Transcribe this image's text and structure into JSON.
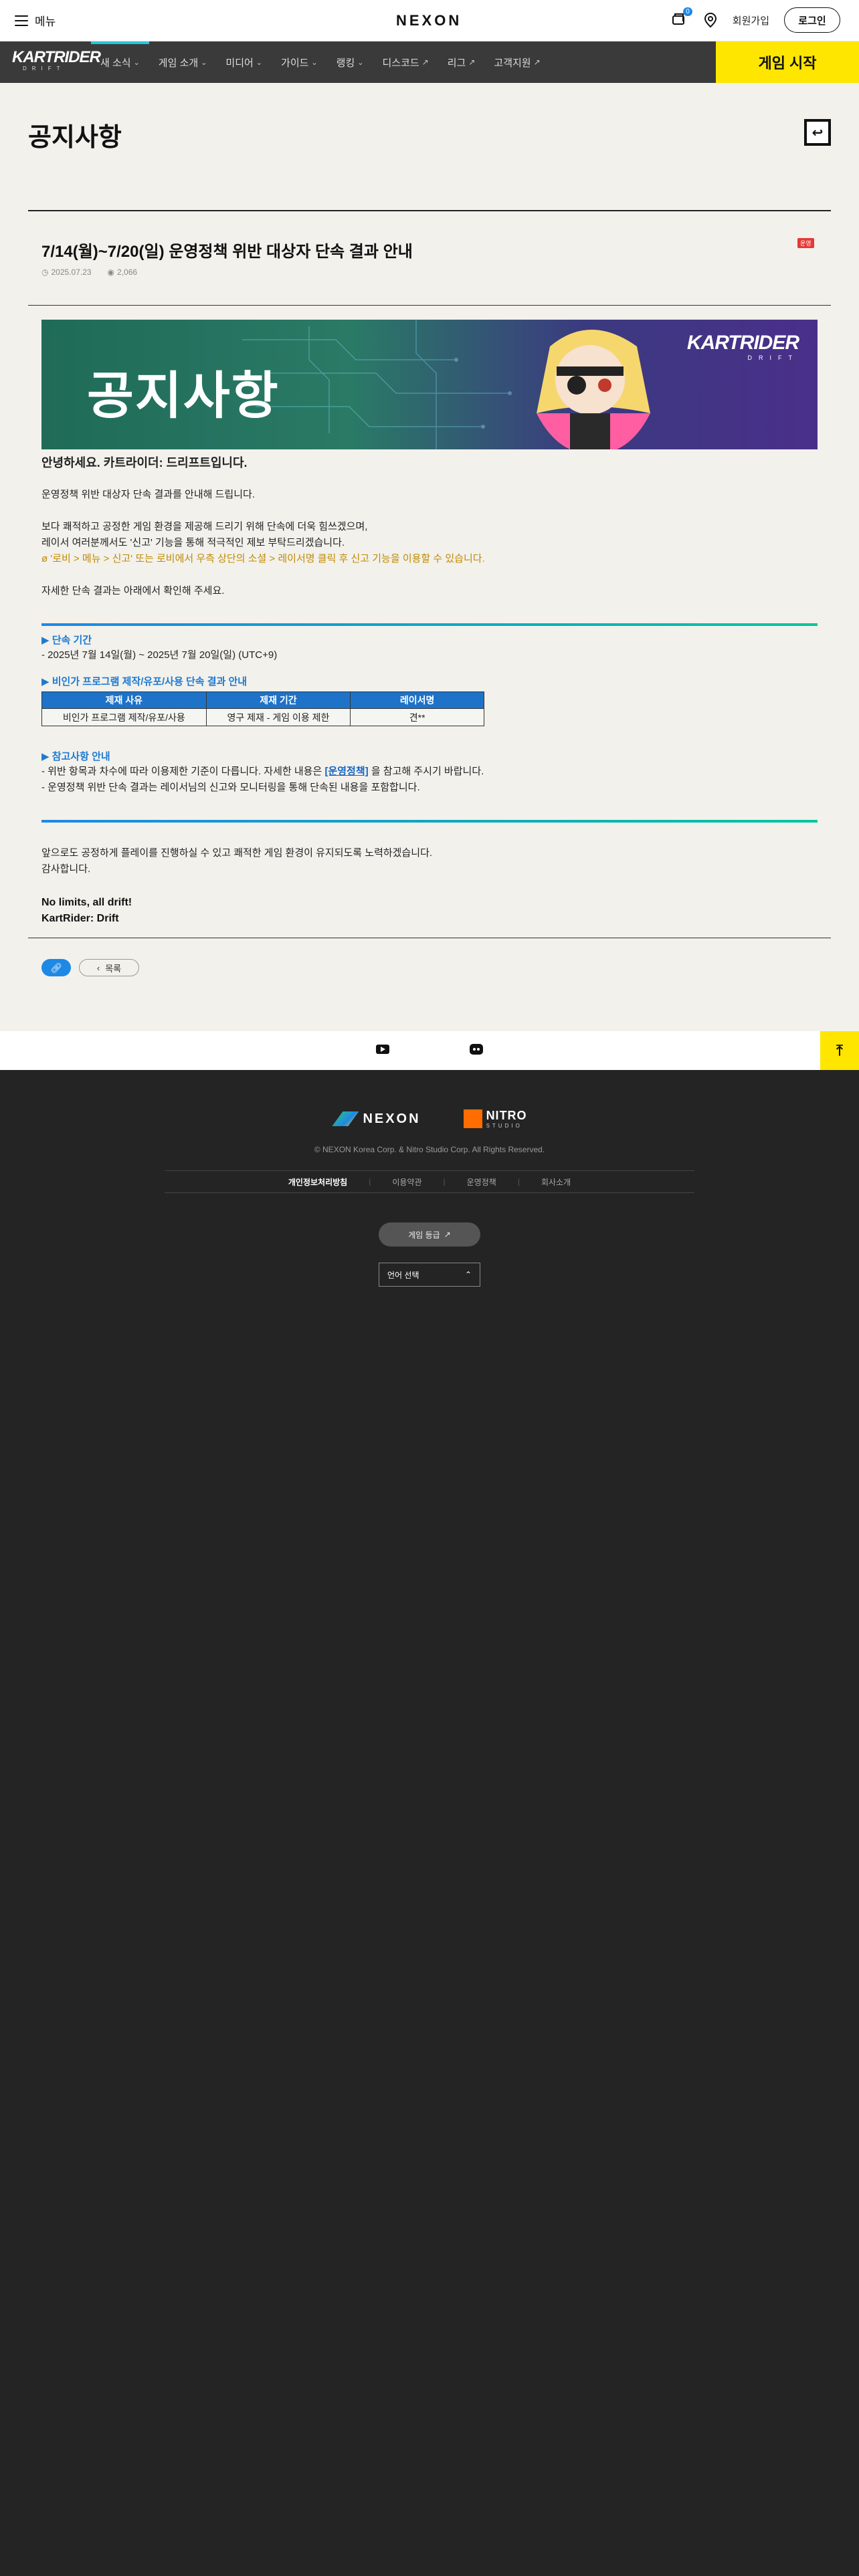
{
  "topbar": {
    "menu_label": "메뉴",
    "logo": "NEXON",
    "notification_count": "0",
    "signup_label": "회원가입",
    "login_label": "로그인"
  },
  "gamenav": {
    "logo_main": "KARTRIDER",
    "logo_sub": "DRIFT",
    "items": [
      {
        "label": "새 소식",
        "icon": "chevron-down-icon"
      },
      {
        "label": "게임 소개",
        "icon": "chevron-down-icon"
      },
      {
        "label": "미디어",
        "icon": "chevron-down-icon"
      },
      {
        "label": "가이드",
        "icon": "chevron-down-icon"
      },
      {
        "label": "랭킹",
        "icon": "chevron-down-icon"
      },
      {
        "label": "디스코드",
        "icon": "external-link-icon"
      },
      {
        "label": "리그",
        "icon": "external-link-icon"
      },
      {
        "label": "고객지원",
        "icon": "external-link-icon"
      }
    ],
    "start_label": "게임 시작",
    "accent_color": "#ffe600"
  },
  "page": {
    "title": "공지사항"
  },
  "article": {
    "tag": "운영",
    "title": "7/14(월)~7/20(일) 운영정책 위반 대상자 단속 결과 안내",
    "date": "2025.07.23",
    "views": "2,066",
    "banner_title": "공지사항",
    "banner_logo_main": "KARTRIDER",
    "banner_logo_sub": "DRIFT",
    "greeting": "안녕하세요. 카트라이더: 드리프트입니다.",
    "intro": "운영정책 위반 대상자 단속 결과를 안내해 드립니다.",
    "para2_line1": "보다 쾌적하고 공정한 게임 환경을 제공해 드리기 위해 단속에 더욱 힘쓰겠으며,",
    "para2_line2": "레이서 여러분께서도 '신고' 기능을 통해 적극적인 제보 부탁드리겠습니다.",
    "para2_line3": "ø '로비 > 메뉴 > 신고' 또는 로비에서 우측 상단의 소셜 > 레이서명 클릭 후 신고 기능을 이용할 수 있습니다.",
    "para3": "자세한 단속 결과는 아래에서 확인해 주세요.",
    "section1_head": "▶ 단속 기간",
    "section1_text": "- 2025년 7월 14일(월) ~ 2025년 7월 20일(일) (UTC+9)",
    "section2_head": "▶ 비인가 프로그램 제작/유포/사용 단속 결과 안내",
    "table": {
      "headers": [
        "제재 사유",
        "제재 기간",
        "레이서명"
      ],
      "rows": [
        [
          "비인가 프로그램 제작/유포/사용",
          "영구 제재 - 게임 이용 제한",
          "견**"
        ]
      ]
    },
    "section3_head": "▶ 참고사항 안내",
    "section3_line1_pre": "- 위반 항목과 차수에 따라 이용제한 기준이 다릅니다. 자세한 내용은 ",
    "section3_link": "[운영정책]",
    "section3_line1_post": " 을 참고해 주시기 바랍니다.",
    "section3_line2": "- 운영정책 위반 단속 결과는 레이서님의 신고와 모니터링을 통해 단속된 내용을 포함합니다.",
    "closing_line1": "앞으로도 공정하게 플레이를 진행하실 수 있고 쾌적한 게임 환경이 유지되도록 노력하겠습니다.",
    "closing_line2": "감사합니다.",
    "slogan_line1": "No limits, all drift!",
    "slogan_line2": "KartRider: Drift",
    "list_label": "목록"
  },
  "footer": {
    "nexon_logo": "NEXON",
    "nitro_logo_main": "NITRO",
    "nitro_logo_sub": "STUDIO",
    "copyright": "© NEXON Korea Corp. & Nitro Studio Corp. All Rights Reserved.",
    "links": [
      "개인정보처리방침",
      "이용약관",
      "운영정책",
      "회사소개"
    ],
    "rating_label": "게임 등급",
    "language_label": "언어 선택"
  }
}
